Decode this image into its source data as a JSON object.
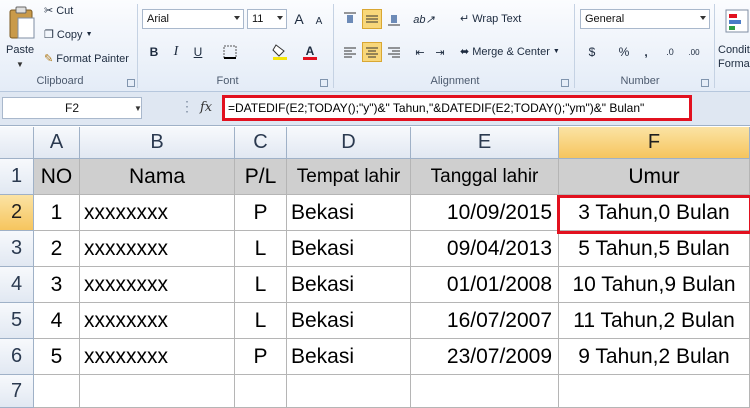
{
  "ribbon": {
    "clipboard": {
      "label": "Clipboard",
      "paste": "Paste",
      "cut": "Cut",
      "copy": "Copy",
      "format_painter": "Format Painter"
    },
    "font": {
      "label": "Font",
      "name": "Arial",
      "size": "11",
      "bold": "B",
      "italic": "I",
      "underline": "U",
      "grow": "A",
      "shrink": "A",
      "font_color": "A"
    },
    "alignment": {
      "label": "Alignment",
      "wrap_text": "Wrap Text",
      "merge_center": "Merge & Center"
    },
    "number": {
      "label": "Number",
      "format": "General",
      "currency": "$",
      "percent": "%",
      "comma": ",",
      "inc_decimal": ".0",
      "dec_decimal": ".00"
    },
    "styles": {
      "conditional_line1": "Conditi",
      "conditional_line2": "Format"
    }
  },
  "formula_bar": {
    "name_box": "F2",
    "fx": "fx",
    "formula": "=DATEDIF(E2;TODAY();\"y\")&\" Tahun,\"&DATEDIF(E2;TODAY();\"ym\")&\" Bulan\""
  },
  "columns": [
    "A",
    "B",
    "C",
    "D",
    "E",
    "F"
  ],
  "row_numbers": [
    "1",
    "2",
    "3",
    "4",
    "5",
    "6",
    "7"
  ],
  "header_row": [
    "NO",
    "Nama",
    "P/L",
    "Tempat lahir",
    "Tanggal lahir",
    "Umur"
  ],
  "rows": [
    [
      "1",
      "xxxxxxxx",
      "P",
      "Bekasi",
      "10/09/2015",
      "3 Tahun,0 Bulan"
    ],
    [
      "2",
      "xxxxxxxx",
      "L",
      "Bekasi",
      "09/04/2013",
      "5 Tahun,5 Bulan"
    ],
    [
      "3",
      "xxxxxxxx",
      "L",
      "Bekasi",
      "01/01/2008",
      "10 Tahun,9 Bulan"
    ],
    [
      "4",
      "xxxxxxxx",
      "L",
      "Bekasi",
      "16/07/2007",
      "11 Tahun,2 Bulan"
    ],
    [
      "5",
      "xxxxxxxx",
      "P",
      "Bekasi",
      "23/07/2009",
      "9 Tahun,2 Bulan"
    ]
  ],
  "selected_cell": "F2",
  "colors": {
    "highlight_red": "#e2111f",
    "header_fill": "#cfcfcf",
    "selected_header": "#f6c55e"
  }
}
